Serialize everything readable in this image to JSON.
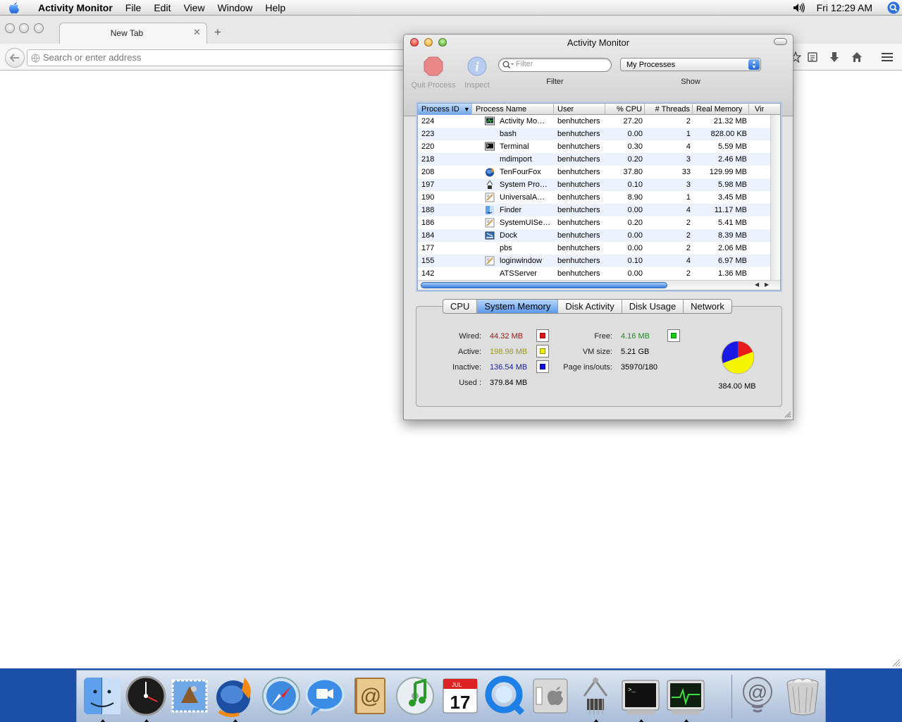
{
  "menubar": {
    "app_name": "Activity Monitor",
    "items": [
      "File",
      "Edit",
      "View",
      "Window",
      "Help"
    ],
    "clock": "Fri 12:29 AM",
    "icons": [
      "apple-icon",
      "volume-icon",
      "spotlight-icon"
    ]
  },
  "browser": {
    "tab_title": "New Tab",
    "tab_close": "✕",
    "tab_add": "+",
    "address_placeholder": "Search or enter address",
    "nav_icons": [
      "back-icon",
      "bookmark-star-icon",
      "reading-list-icon",
      "download-icon",
      "home-icon",
      "menu-icon"
    ]
  },
  "activity_monitor": {
    "title": "Activity Monitor",
    "toolbar": {
      "quit_label": "Quit Process",
      "inspect_label": "Inspect",
      "filter_placeholder": "Filter",
      "filter_label": "Filter",
      "show_value": "My Processes",
      "show_label": "Show"
    },
    "table": {
      "columns": [
        "Process ID",
        "Process Name",
        "User",
        "% CPU",
        "# Threads",
        "Real Memory",
        "Vir"
      ],
      "sort_indicator": "▼",
      "rows": [
        {
          "pid": "224",
          "name": "Activity Mo…",
          "user": "benhutchers",
          "cpu": "27.20",
          "threads": "2",
          "mem": "21.32 MB",
          "icon": "activity-monitor"
        },
        {
          "pid": "223",
          "name": "bash",
          "user": "benhutchers",
          "cpu": "0.00",
          "threads": "1",
          "mem": "828.00 KB",
          "icon": ""
        },
        {
          "pid": "220",
          "name": "Terminal",
          "user": "benhutchers",
          "cpu": "0.30",
          "threads": "4",
          "mem": "5.59 MB",
          "icon": "terminal"
        },
        {
          "pid": "218",
          "name": "mdimport",
          "user": "benhutchers",
          "cpu": "0.20",
          "threads": "3",
          "mem": "2.46 MB",
          "icon": ""
        },
        {
          "pid": "208",
          "name": "TenFourFox",
          "user": "benhutchers",
          "cpu": "37.80",
          "threads": "33",
          "mem": "129.99 MB",
          "icon": "tenfourfox"
        },
        {
          "pid": "197",
          "name": "System Pro…",
          "user": "benhutchers",
          "cpu": "0.10",
          "threads": "3",
          "mem": "5.98 MB",
          "icon": "system-profiler"
        },
        {
          "pid": "190",
          "name": "UniversalA…",
          "user": "benhutchers",
          "cpu": "8.90",
          "threads": "1",
          "mem": "3.45 MB",
          "icon": "generic-app"
        },
        {
          "pid": "188",
          "name": "Finder",
          "user": "benhutchers",
          "cpu": "0.00",
          "threads": "4",
          "mem": "11.17 MB",
          "icon": "finder"
        },
        {
          "pid": "186",
          "name": "SystemUISe…",
          "user": "benhutchers",
          "cpu": "0.20",
          "threads": "2",
          "mem": "5.41 MB",
          "icon": "generic-app"
        },
        {
          "pid": "184",
          "name": "Dock",
          "user": "benhutchers",
          "cpu": "0.00",
          "threads": "2",
          "mem": "8.39 MB",
          "icon": "dock"
        },
        {
          "pid": "177",
          "name": "pbs",
          "user": "benhutchers",
          "cpu": "0.00",
          "threads": "2",
          "mem": "2.06 MB",
          "icon": ""
        },
        {
          "pid": "155",
          "name": "loginwindow",
          "user": "benhutchers",
          "cpu": "0.10",
          "threads": "4",
          "mem": "6.97 MB",
          "icon": "generic-app"
        },
        {
          "pid": "142",
          "name": "ATSServer",
          "user": "benhutchers",
          "cpu": "0.00",
          "threads": "2",
          "mem": "1.36 MB",
          "icon": ""
        }
      ]
    },
    "tabs": [
      "CPU",
      "System Memory",
      "Disk Activity",
      "Disk Usage",
      "Network"
    ],
    "active_tab": "System Memory",
    "memory": {
      "wired_label": "Wired:",
      "wired_value": "44.32 MB",
      "wired_color": "#a01818",
      "active_label": "Active:",
      "active_value": "198.98 MB",
      "active_color": "#9a9a20",
      "inactive_label": "Inactive:",
      "inactive_value": "136.54 MB",
      "inactive_color": "#1c1c9c",
      "used_label": "Used :",
      "used_value": "379.84 MB",
      "free_label": "Free:",
      "free_value": "4.16 MB",
      "free_color": "#1a8c1a",
      "vm_label": "VM size:",
      "vm_value": "5.21 GB",
      "pageins_label": "Page ins/outs:",
      "pageins_value": "35970/180",
      "total": "384.00 MB",
      "swatch_colors": {
        "wired": "#e81010",
        "active": "#f2f200",
        "inactive": "#1010e8",
        "free": "#10d010"
      }
    }
  },
  "dock": {
    "items": [
      "finder",
      "dashboard",
      "mail",
      "tenfourfox",
      "safari",
      "ichat",
      "address-book",
      "itunes",
      "ical",
      "quicktime",
      "system-preferences",
      "system-profiler",
      "terminal",
      "activity-monitor",
      "downloads-stack",
      "trash"
    ],
    "running": [
      "finder",
      "dashboard",
      "tenfourfox",
      "system-profiler",
      "terminal",
      "activity-monitor"
    ]
  }
}
